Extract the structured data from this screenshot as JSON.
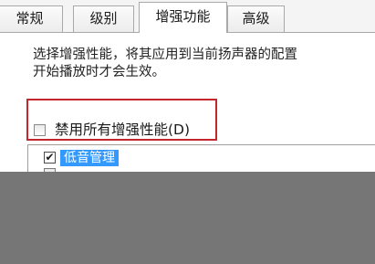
{
  "tabs": [
    {
      "label": "常规"
    },
    {
      "label": "级别"
    },
    {
      "label": "增强功能"
    },
    {
      "label": "高级"
    }
  ],
  "description": {
    "line1": "选择增强性能，将其应用到当前扬声器的配置",
    "line2": "开始播放时才会生效。"
  },
  "disable_all": {
    "label": "禁用所有增强性能(D)",
    "checked": false
  },
  "enhancements": {
    "items": [
      {
        "label": "低音管理",
        "checked": true,
        "selected": true
      },
      {
        "label": "",
        "checked": false,
        "selected": false
      }
    ]
  },
  "colors": {
    "highlight_border": "#c4262e",
    "selection": "#3399ff",
    "overlay": "#767676"
  }
}
